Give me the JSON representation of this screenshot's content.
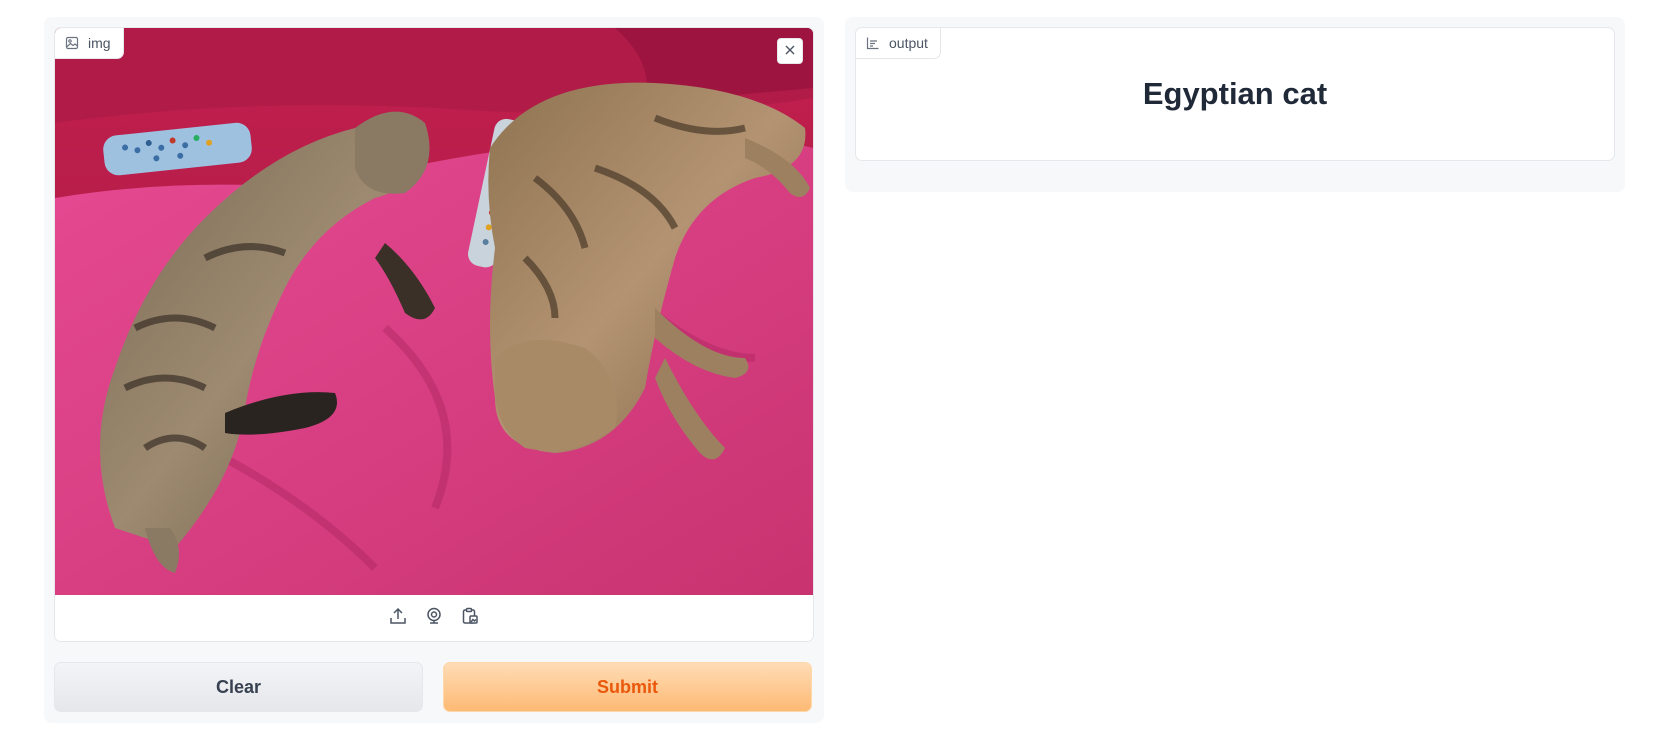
{
  "input": {
    "label": "img",
    "icon": "image-icon",
    "remove_icon": "close-icon",
    "sources": [
      "upload-icon",
      "webcam-icon",
      "clipboard-icon"
    ]
  },
  "output": {
    "label": "output",
    "icon": "bar-chart-icon",
    "prediction": "Egyptian cat"
  },
  "buttons": {
    "clear": "Clear",
    "submit": "Submit"
  },
  "colors": {
    "submit_text": "#ea580c",
    "submit_bg": "#fdba74",
    "blanket": "#d83f83",
    "panel_bg": "#f7f8fa"
  }
}
